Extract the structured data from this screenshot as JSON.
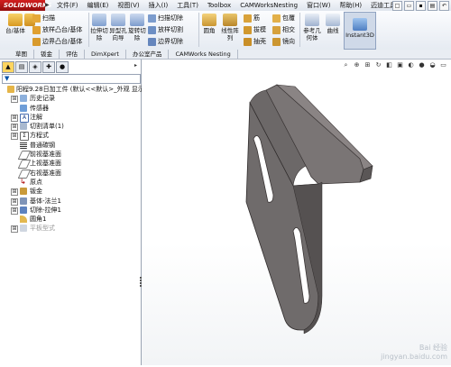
{
  "app": {
    "logo_text": "SOLIDWORKS",
    "logo_arrow": "▶",
    "colors": {
      "logo_red": "#c41a1a",
      "model_gray": "#6e6a6a",
      "accent_blue": "#1f5fbf"
    }
  },
  "menu": [
    "文件(F)",
    "编辑(E)",
    "视图(V)",
    "插入(I)",
    "工具(T)",
    "Toolbox",
    "CAMWorksNesting",
    "窗口(W)",
    "帮助(H)",
    "迈迪工具集"
  ],
  "quick_access": [
    "new-icon",
    "open-icon",
    "save-icon",
    "print-icon",
    "undo-icon"
  ],
  "ribbon": {
    "left_stack": [
      "扫描",
      "放样凸台/基体",
      "边界凸台/基体"
    ],
    "big_buttons": {
      "extrude": "旋转凸台/基体",
      "extrude_prefix": "台/基体",
      "cut": "拉伸切除",
      "hole": "异型孔向导",
      "revolve_cut": "旋转切除"
    },
    "cut_stack": [
      "扫描切除",
      "放样切割",
      "边界切除"
    ],
    "fillet": "圆角",
    "pattern": "线性阵列",
    "mid_stack": [
      "筋",
      "拔模",
      "抽壳"
    ],
    "right_stack": [
      "包覆",
      "相交",
      "镜向"
    ],
    "ref_geom": "参考几何体",
    "curves": "曲线",
    "instant3d": "Instant3D"
  },
  "tabs": [
    "草图",
    "钣金",
    "评估",
    "DimXpert",
    "办公室产品",
    "CAMWorks Nesting"
  ],
  "tree": {
    "expander_open": "⊟",
    "expander_closed": "⊞",
    "filter_icon": "▼",
    "root": "阳程9.28日加工件 (默认<<默认>_外观 显示",
    "items": [
      {
        "label": "历史记录",
        "expander": true,
        "icon": "history-icon"
      },
      {
        "label": "传感器",
        "expander": false,
        "icon": "sensor-icon"
      },
      {
        "label": "注解",
        "expander": true,
        "icon": "annotation-icon"
      },
      {
        "label": "切割清单(1)",
        "expander": true,
        "icon": "cutlist-icon"
      },
      {
        "label": "方程式",
        "expander": true,
        "icon": "equation-icon"
      },
      {
        "label": "普通碳钢",
        "expander": false,
        "icon": "material-icon"
      },
      {
        "label": "前视基准面",
        "expander": false,
        "icon": "plane-icon"
      },
      {
        "label": "上视基准面",
        "expander": false,
        "icon": "plane-icon"
      },
      {
        "label": "右视基准面",
        "expander": false,
        "icon": "plane-icon"
      },
      {
        "label": "原点",
        "expander": false,
        "icon": "origin-icon"
      },
      {
        "label": "钣金",
        "expander": true,
        "icon": "sheetmetal-icon"
      },
      {
        "label": "基体-法兰1",
        "expander": true,
        "icon": "flange-icon"
      },
      {
        "label": "切除-拉伸1",
        "expander": true,
        "icon": "cut-extrude-icon"
      },
      {
        "label": "圆角1",
        "expander": false,
        "icon": "fillet-icon"
      },
      {
        "label": "平板型式",
        "expander": true,
        "icon": "flat-pattern-icon",
        "dim": true
      }
    ]
  },
  "view_tools": [
    "search-icon",
    "zoom-fit-icon",
    "zoom-area-icon",
    "rotate-icon",
    "section-icon",
    "display-style-icon",
    "hide-show-icon",
    "appearance-icon",
    "scene-icon",
    "monitor-icon"
  ],
  "watermark": [
    "Bai 经验",
    "jingyan.baidu.com"
  ]
}
